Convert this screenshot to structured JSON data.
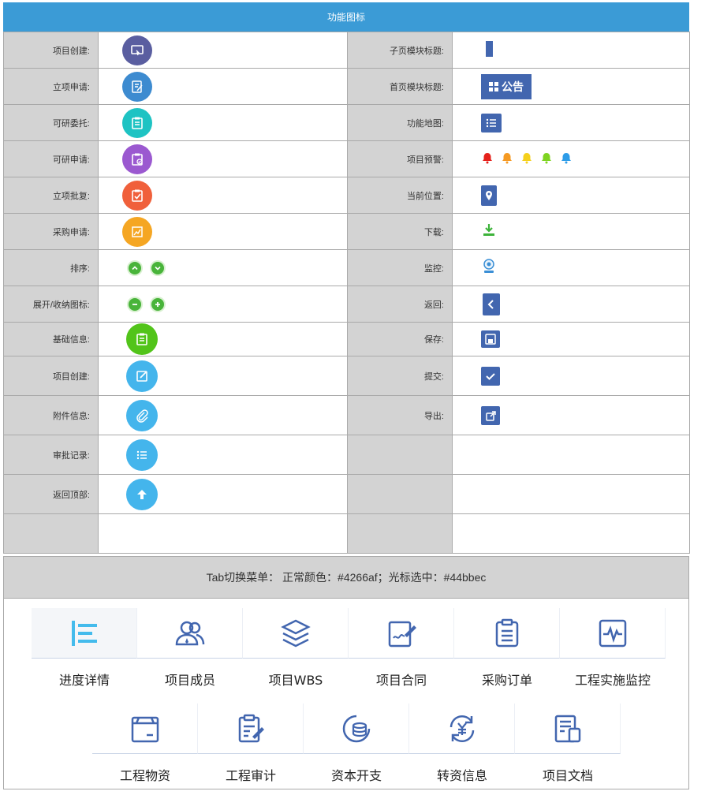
{
  "header": {
    "title": "功能图标"
  },
  "rows": [
    {
      "left_label": "项目创建:",
      "right_label": "子页模块标题:"
    },
    {
      "left_label": "立项申请:",
      "right_label": "首页模块标题:"
    },
    {
      "left_label": "可研委托:",
      "right_label": "功能地图:"
    },
    {
      "left_label": "可研申请:",
      "right_label": "项目预警:"
    },
    {
      "left_label": "立项批复:",
      "right_label": "当前位置:"
    },
    {
      "left_label": "采购申请:",
      "right_label": "下载:"
    },
    {
      "left_label": "排序:",
      "right_label": "监控:"
    },
    {
      "left_label": "展开/收纳图标:",
      "right_label": "返回:"
    },
    {
      "left_label": "基础信息:",
      "right_label": "保存:"
    },
    {
      "left_label": "项目创建:",
      "right_label": "提交:"
    },
    {
      "left_label": "附件信息:",
      "right_label": "导出:"
    },
    {
      "left_label": "审批记录:",
      "right_label": ""
    },
    {
      "left_label": "返回顶部:",
      "right_label": ""
    },
    {
      "left_label": "",
      "right_label": ""
    }
  ],
  "notice_button": {
    "label": "公告"
  },
  "tabs_section": {
    "title": "Tab切换菜单：  正常颜色：#4266af；光标选中：#44bbec",
    "normal_color": "#4266af",
    "hover_color": "#44bbec",
    "tabs_row1": [
      {
        "label": "进度详情",
        "icon": "progress-icon"
      },
      {
        "label": "项目成员",
        "icon": "members-icon"
      },
      {
        "label": "项目WBS",
        "icon": "layers-icon"
      },
      {
        "label": "项目合同",
        "icon": "contract-icon"
      },
      {
        "label": "采购订单",
        "icon": "order-icon"
      },
      {
        "label": "工程实施监控",
        "icon": "monitor-icon"
      }
    ],
    "tabs_row2": [
      {
        "label": "工程物资",
        "icon": "materials-icon"
      },
      {
        "label": "工程审计",
        "icon": "audit-icon"
      },
      {
        "label": "资本开支",
        "icon": "capex-icon"
      },
      {
        "label": "转资信息",
        "icon": "transfer-icon"
      },
      {
        "label": "项目文档",
        "icon": "document-icon"
      }
    ]
  },
  "colors": {
    "header_bg": "#3b9bd6",
    "icon_blue": "#4266af",
    "purple": "#5a5ea0",
    "blue": "#3d8bd0",
    "teal": "#1ec3c3",
    "violet": "#9b59d0",
    "red_orange": "#f0603b",
    "orange": "#f5a623",
    "green": "#49b43a",
    "bright_green": "#52c41a",
    "sky": "#44b5ec"
  }
}
